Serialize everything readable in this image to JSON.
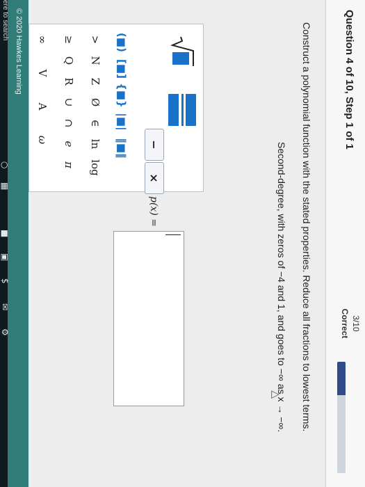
{
  "header": {
    "title": "Question 4 of 10, Step 1 of 1",
    "score_fraction": "3/10",
    "score_label": "Correct",
    "progress_fraction": 0.3
  },
  "question": {
    "instruction": "Construct a polynomial function with the stated properties. Reduce all fractions to lowest terms.",
    "prompt": "Second-degree, with zeros of −4 and 1, and goes to −∞ as x → −∞."
  },
  "keypad": {
    "minus_label": "−",
    "times_label": "×",
    "rows": [
      [
        "(■)",
        "[■]",
        "{■}",
        "|■|",
        "‖■‖"
      ],
      [
        ">",
        "N",
        "Z",
        "Ø",
        "∈",
        "ln",
        "log"
      ],
      [
        "≥",
        "Q",
        "R",
        "∪",
        "∩",
        "e",
        "π"
      ],
      [
        "∞",
        "V",
        "A",
        "ω"
      ]
    ]
  },
  "answer": {
    "label": "p(x) =",
    "value": ""
  },
  "footer": {
    "copyright": "© 2020 Hawkes Learning"
  },
  "taskbar": {
    "search_text": "ere to search",
    "icons": [
      "cortana-circle-icon",
      "task-view-icon",
      "explorer-icon",
      "store-icon",
      "dollar-app-icon",
      "mail-icon",
      "settings-gear-icon"
    ]
  },
  "colors": {
    "accent_blue": "#1a72c8",
    "progress": "#2f4a88",
    "footer": "#2f7c79"
  }
}
